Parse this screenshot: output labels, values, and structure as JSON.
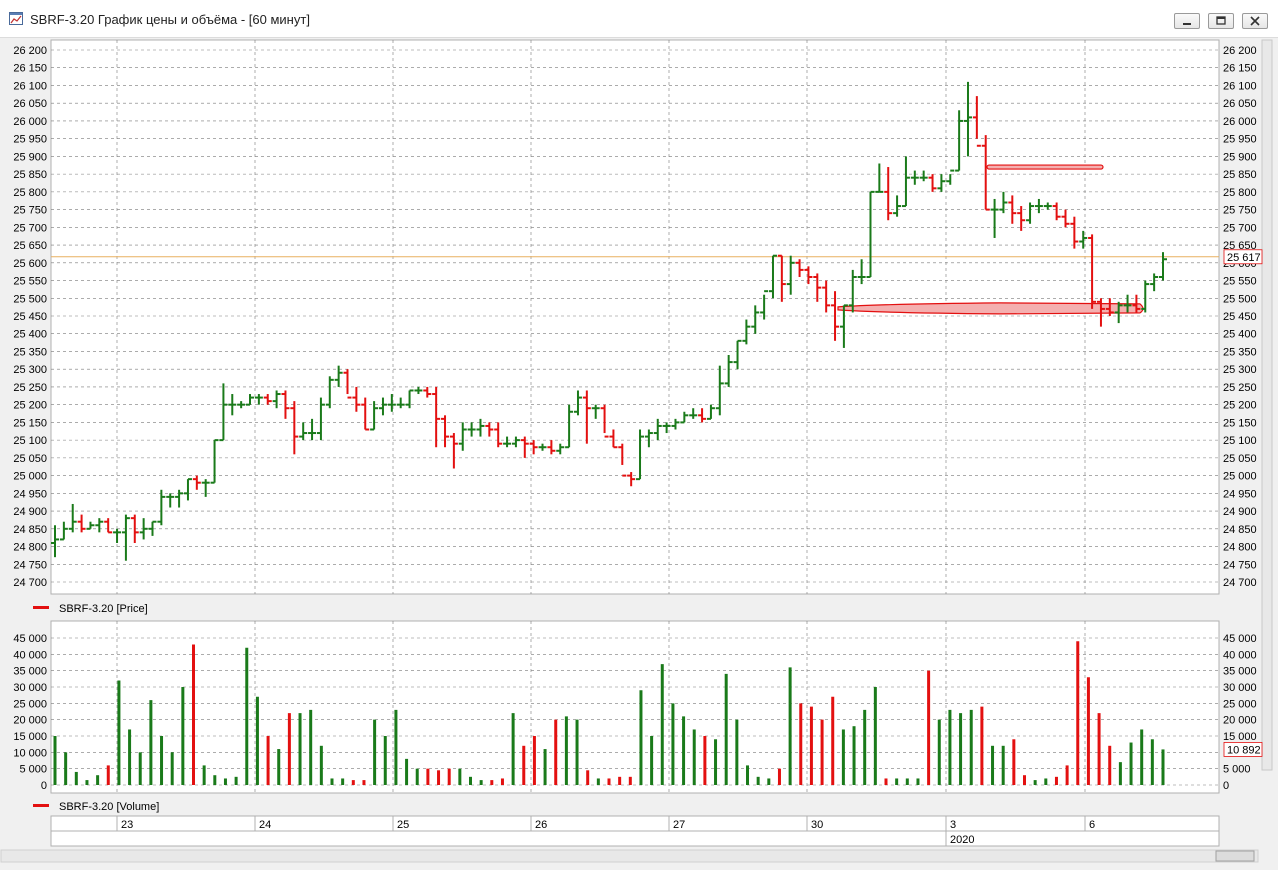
{
  "window": {
    "title": "SBRF-3.20 График цены и объёма - [60 минут]",
    "buttons": [
      "minimize",
      "restore",
      "close"
    ]
  },
  "colors": {
    "up": "#1a7a1a",
    "down": "#e31010",
    "last_price_line": "#e8b060",
    "grid": "#7a7a7a",
    "level_marker": "#e31010"
  },
  "chart_data": [
    {
      "type": "ohlc",
      "legend": "SBRF-3.20 [Price]",
      "ylim": [
        24700,
        26200
      ],
      "yticks": [
        "26 200",
        "26 150",
        "26 100",
        "26 050",
        "26 000",
        "25 950",
        "25 900",
        "25 850",
        "25 800",
        "25 750",
        "25 700",
        "25 650",
        "25 600",
        "25 550",
        "25 500",
        "25 450",
        "25 400",
        "25 350",
        "25 300",
        "25 250",
        "25 200",
        "25 150",
        "25 100",
        "25 050",
        "25 000",
        "24 950",
        "24 900",
        "24 850",
        "24 800",
        "24 750",
        "24 700"
      ],
      "last_price": 25617,
      "last_price_label": "25 617",
      "bars": [
        [
          24810,
          24860,
          24770,
          24820
        ],
        [
          24820,
          24870,
          24820,
          24850
        ],
        [
          24850,
          24920,
          24840,
          24870
        ],
        [
          24870,
          24890,
          24840,
          24850
        ],
        [
          24850,
          24870,
          24850,
          24860
        ],
        [
          24860,
          24880,
          24840,
          24870
        ],
        [
          24870,
          24880,
          24840,
          24840
        ],
        [
          24840,
          24850,
          24810,
          24840
        ],
        [
          24840,
          24890,
          24760,
          24880
        ],
        [
          24880,
          24890,
          24810,
          24840
        ],
        [
          24840,
          24880,
          24820,
          24850
        ],
        [
          24850,
          24870,
          24830,
          24870
        ],
        [
          24870,
          24960,
          24860,
          24940
        ],
        [
          24940,
          24950,
          24910,
          24940
        ],
        [
          24940,
          24960,
          24910,
          24950
        ],
        [
          24950,
          24990,
          24930,
          24990
        ],
        [
          24990,
          25000,
          24960,
          24980
        ],
        [
          24980,
          24990,
          24940,
          24980
        ],
        [
          24980,
          25100,
          24980,
          25100
        ],
        [
          25100,
          25260,
          25100,
          25200
        ],
        [
          25200,
          25230,
          25170,
          25200
        ],
        [
          25200,
          25210,
          25190,
          25200
        ],
        [
          25200,
          25230,
          25200,
          25220
        ],
        [
          25220,
          25230,
          25200,
          25220
        ],
        [
          25220,
          25230,
          25200,
          25210
        ],
        [
          25210,
          25240,
          25190,
          25230
        ],
        [
          25230,
          25240,
          25160,
          25190
        ],
        [
          25190,
          25210,
          25060,
          25110
        ],
        [
          25110,
          25150,
          25100,
          25120
        ],
        [
          25120,
          25160,
          25100,
          25120
        ],
        [
          25120,
          25220,
          25100,
          25200
        ],
        [
          25200,
          25280,
          25190,
          25270
        ],
        [
          25270,
          25310,
          25250,
          25290
        ],
        [
          25290,
          25300,
          25230,
          25220
        ],
        [
          25220,
          25250,
          25180,
          25200
        ],
        [
          25200,
          25220,
          25130,
          25130
        ],
        [
          25130,
          25210,
          25130,
          25190
        ],
        [
          25190,
          25220,
          25170,
          25200
        ],
        [
          25200,
          25230,
          25180,
          25200
        ],
        [
          25200,
          25220,
          25190,
          25200
        ],
        [
          25200,
          25240,
          25190,
          25240
        ],
        [
          25240,
          25250,
          25230,
          25240
        ],
        [
          25240,
          25250,
          25220,
          25230
        ],
        [
          25230,
          25250,
          25080,
          25160
        ],
        [
          25160,
          25170,
          25080,
          25110
        ],
        [
          25110,
          25120,
          25020,
          25090
        ],
        [
          25090,
          25150,
          25070,
          25130
        ],
        [
          25130,
          25150,
          25110,
          25130
        ],
        [
          25130,
          25160,
          25110,
          25140
        ],
        [
          25140,
          25150,
          25110,
          25130
        ],
        [
          25130,
          25150,
          25080,
          25090
        ],
        [
          25090,
          25110,
          25080,
          25090
        ],
        [
          25090,
          25110,
          25080,
          25100
        ],
        [
          25100,
          25110,
          25050,
          25090
        ],
        [
          25090,
          25100,
          25060,
          25080
        ],
        [
          25080,
          25090,
          25070,
          25080
        ],
        [
          25080,
          25100,
          25060,
          25070
        ],
        [
          25070,
          25090,
          25060,
          25080
        ],
        [
          25080,
          25200,
          25080,
          25180
        ],
        [
          25180,
          25240,
          25170,
          25220
        ],
        [
          25220,
          25240,
          25090,
          25190
        ],
        [
          25190,
          25200,
          25160,
          25190
        ],
        [
          25190,
          25200,
          25120,
          25110
        ],
        [
          25110,
          25130,
          25080,
          25080
        ],
        [
          25080,
          25090,
          25030,
          25000
        ],
        [
          25000,
          25010,
          24970,
          24990
        ],
        [
          24990,
          25130,
          24990,
          25110
        ],
        [
          25110,
          25130,
          25080,
          25120
        ],
        [
          25120,
          25160,
          25100,
          25140
        ],
        [
          25140,
          25150,
          25120,
          25140
        ],
        [
          25140,
          25160,
          25130,
          25150
        ],
        [
          25150,
          25180,
          25150,
          25170
        ],
        [
          25170,
          25190,
          25160,
          25170
        ],
        [
          25170,
          25190,
          25150,
          25160
        ],
        [
          25160,
          25200,
          25160,
          25190
        ],
        [
          25190,
          25310,
          25170,
          25260
        ],
        [
          25260,
          25340,
          25250,
          25320
        ],
        [
          25320,
          25380,
          25300,
          25380
        ],
        [
          25380,
          25440,
          25370,
          25420
        ],
        [
          25420,
          25480,
          25400,
          25460
        ],
        [
          25460,
          25510,
          25440,
          25520
        ],
        [
          25520,
          25620,
          25500,
          25620
        ],
        [
          25620,
          25620,
          25490,
          25540
        ],
        [
          25540,
          25620,
          25510,
          25600
        ],
        [
          25600,
          25610,
          25560,
          25580
        ],
        [
          25580,
          25590,
          25540,
          25560
        ],
        [
          25560,
          25570,
          25490,
          25530
        ],
        [
          25530,
          25550,
          25460,
          25480
        ],
        [
          25480,
          25520,
          25380,
          25420
        ],
        [
          25420,
          25480,
          25360,
          25480
        ],
        [
          25480,
          25580,
          25460,
          25560
        ],
        [
          25560,
          25610,
          25540,
          25560
        ],
        [
          25560,
          25800,
          25560,
          25800
        ],
        [
          25800,
          25880,
          25800,
          25800
        ],
        [
          25800,
          25870,
          25720,
          25740
        ],
        [
          25740,
          25790,
          25730,
          25760
        ],
        [
          25760,
          25900,
          25760,
          25840
        ],
        [
          25840,
          25860,
          25820,
          25840
        ],
        [
          25840,
          25860,
          25830,
          25840
        ],
        [
          25840,
          25850,
          25800,
          25810
        ],
        [
          25810,
          25850,
          25800,
          25830
        ],
        [
          25830,
          25850,
          25820,
          25860
        ],
        [
          25860,
          26030,
          25860,
          26000
        ],
        [
          26000,
          26110,
          25900,
          26010
        ],
        [
          26010,
          26070,
          25950,
          25930
        ],
        [
          25930,
          25960,
          25750,
          25750
        ],
        [
          25750,
          25780,
          25670,
          25750
        ],
        [
          25750,
          25800,
          25740,
          25770
        ],
        [
          25770,
          25790,
          25710,
          25740
        ],
        [
          25740,
          25760,
          25690,
          25720
        ],
        [
          25720,
          25770,
          25710,
          25760
        ],
        [
          25760,
          25780,
          25740,
          25760
        ],
        [
          25760,
          25770,
          25750,
          25760
        ],
        [
          25760,
          25770,
          25720,
          25730
        ],
        [
          25730,
          25750,
          25700,
          25710
        ],
        [
          25710,
          25730,
          25640,
          25660
        ],
        [
          25660,
          25690,
          25640,
          25670
        ],
        [
          25670,
          25680,
          25470,
          25490
        ],
        [
          25490,
          25500,
          25420,
          25470
        ],
        [
          25470,
          25500,
          25450,
          25460
        ],
        [
          25460,
          25490,
          25430,
          25480
        ],
        [
          25480,
          25510,
          25460,
          25480
        ],
        [
          25480,
          25510,
          25460,
          25470
        ],
        [
          25470,
          25550,
          25460,
          25540
        ],
        [
          25540,
          25570,
          25520,
          25560
        ],
        [
          25560,
          25630,
          25550,
          25610
        ]
      ],
      "levels": [
        {
          "from_price": 25870,
          "kind": "sell-wall"
        },
        {
          "from_price": 25470,
          "kind": "buy-wall"
        }
      ],
      "x_labels": [
        "23",
        "24",
        "25",
        "26",
        "27",
        "30",
        "3",
        "6"
      ],
      "x_year_label": "2020"
    },
    {
      "type": "bar",
      "legend": "SBRF-3.20 [Volume]",
      "ylim": [
        0,
        45000
      ],
      "yticks": [
        "45 000",
        "40 000",
        "35 000",
        "30 000",
        "25 000",
        "20 000",
        "15 000",
        "10 000",
        "5 000",
        "0"
      ],
      "last_volume_label": "10 892",
      "values": [
        15000,
        10000,
        4000,
        1500,
        3000,
        6000,
        32000,
        17000,
        10000,
        26000,
        15000,
        10000,
        30000,
        43000,
        6000,
        3000,
        2000,
        2500,
        42000,
        27000,
        15000,
        11000,
        22000,
        22000,
        23000,
        12000,
        2000,
        2000,
        1500,
        1500,
        20000,
        15000,
        23000,
        8000,
        5000,
        5000,
        4500,
        5000,
        5000,
        2500,
        1500,
        1500,
        2000,
        22000,
        12000,
        15000,
        11000,
        20000,
        21000,
        20000,
        4500,
        2000,
        2000,
        2500,
        2500,
        29000,
        15000,
        37000,
        25000,
        21000,
        17000,
        15000,
        14000,
        34000,
        20000,
        6000,
        2500,
        2000,
        5000,
        36000,
        25000,
        24000,
        20000,
        27000,
        17000,
        18000,
        23000,
        30000,
        2000,
        2000,
        2000,
        2000,
        35000,
        20000,
        23000,
        22000,
        23000,
        24000,
        12000,
        12000,
        14000,
        3000,
        1500,
        2000,
        2500,
        6000,
        44000,
        33000,
        22000,
        12000,
        7000,
        13000,
        17000,
        14000,
        10892
      ]
    }
  ]
}
